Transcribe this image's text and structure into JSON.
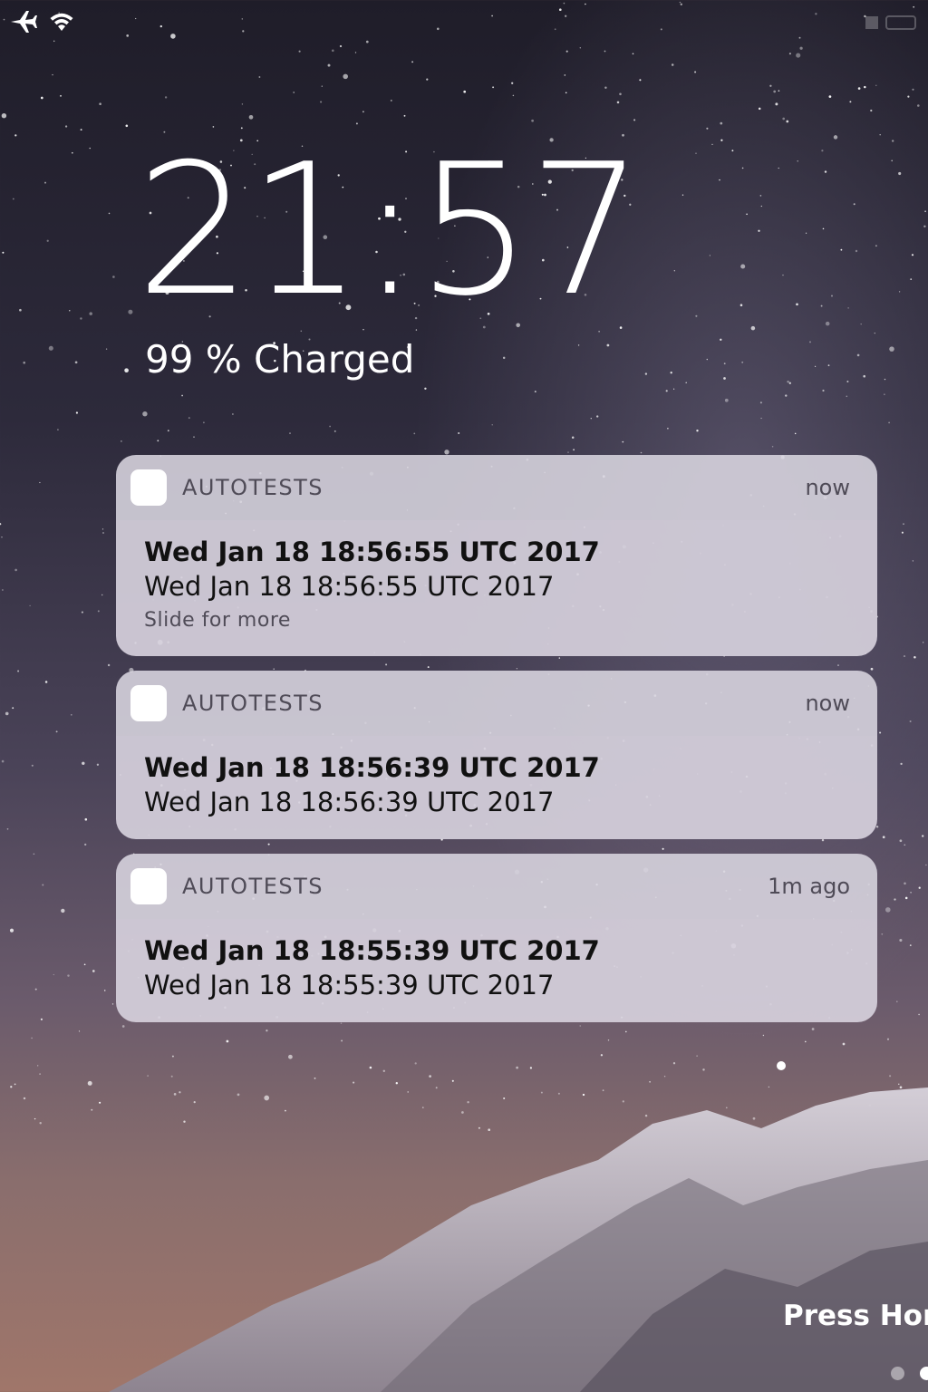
{
  "status_bar": {
    "left_icons": [
      "airplane-icon",
      "wifi-icon"
    ]
  },
  "lock_screen": {
    "time": "21:57",
    "charge_status": "99 % Charged"
  },
  "notifications": [
    {
      "app_name": "AUTOTESTS",
      "time": "now",
      "title": "Wed Jan 18 18:56:55 UTC 2017",
      "body": "Wed Jan 18 18:56:55 UTC 2017",
      "hint": "Slide for more"
    },
    {
      "app_name": "AUTOTESTS",
      "time": "now",
      "title": "Wed Jan 18 18:56:39 UTC 2017",
      "body": "Wed Jan 18 18:56:39 UTC 2017"
    },
    {
      "app_name": "AUTOTESTS",
      "time": "1m ago",
      "title": "Wed Jan 18 18:55:39 UTC 2017",
      "body": "Wed Jan 18 18:55:39 UTC 2017"
    }
  ],
  "footer": {
    "press_home": "Press Hon",
    "page_count": 2,
    "current_page": 2
  },
  "colors": {
    "notification_background": "#d8d3de",
    "text_primary": "#111111",
    "text_secondary": "#4f4b57"
  }
}
